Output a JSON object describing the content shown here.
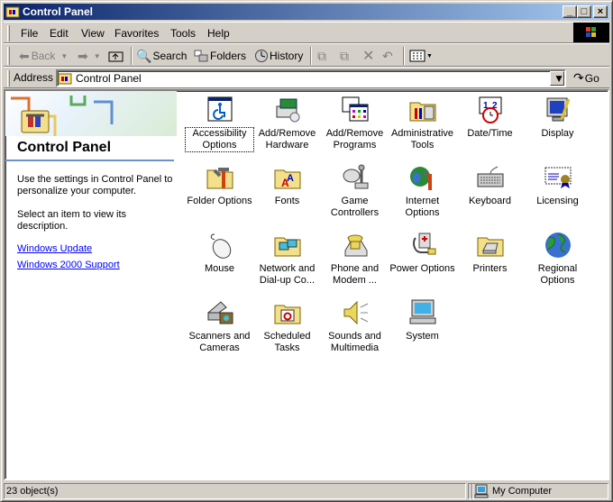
{
  "window": {
    "title": "Control Panel",
    "buttons": {
      "minimize": "_",
      "maximize": "□",
      "close": "×"
    }
  },
  "menubar": {
    "items": [
      "File",
      "Edit",
      "View",
      "Favorites",
      "Tools",
      "Help"
    ]
  },
  "toolbar": {
    "back": "Back",
    "search": "Search",
    "folders": "Folders",
    "history": "History"
  },
  "addressbar": {
    "label": "Address",
    "value": "Control Panel",
    "go": "Go"
  },
  "leftpane": {
    "title": "Control Panel",
    "description": "Use the settings in Control Panel to personalize your computer.",
    "hint": "Select an item to view its description.",
    "links": [
      "Windows Update",
      "Windows 2000 Support"
    ]
  },
  "items": [
    {
      "label": "Accessibility Options",
      "icon": "accessibility-icon"
    },
    {
      "label": "Add/Remove Hardware",
      "icon": "add-remove-hardware-icon"
    },
    {
      "label": "Add/Remove Programs",
      "icon": "add-remove-programs-icon"
    },
    {
      "label": "Administrative Tools",
      "icon": "administrative-tools-icon"
    },
    {
      "label": "Date/Time",
      "icon": "date-time-icon"
    },
    {
      "label": "Display",
      "icon": "display-icon"
    },
    {
      "label": "Folder Options",
      "icon": "folder-options-icon"
    },
    {
      "label": "Fonts",
      "icon": "fonts-icon"
    },
    {
      "label": "Game Controllers",
      "icon": "game-controllers-icon"
    },
    {
      "label": "Internet Options",
      "icon": "internet-options-icon"
    },
    {
      "label": "Keyboard",
      "icon": "keyboard-icon"
    },
    {
      "label": "Licensing",
      "icon": "licensing-icon"
    },
    {
      "label": "Mouse",
      "icon": "mouse-icon"
    },
    {
      "label": "Network and Dial-up Co...",
      "icon": "network-icon"
    },
    {
      "label": "Phone and Modem ...",
      "icon": "phone-modem-icon"
    },
    {
      "label": "Power Options",
      "icon": "power-options-icon"
    },
    {
      "label": "Printers",
      "icon": "printers-icon"
    },
    {
      "label": "Regional Options",
      "icon": "regional-options-icon"
    },
    {
      "label": "Scanners and Cameras",
      "icon": "scanners-cameras-icon"
    },
    {
      "label": "Scheduled Tasks",
      "icon": "scheduled-tasks-icon"
    },
    {
      "label": "Sounds and Multimedia",
      "icon": "sounds-multimedia-icon"
    },
    {
      "label": "System",
      "icon": "system-icon"
    }
  ],
  "statusbar": {
    "count": "23 object(s)",
    "zone": "My Computer"
  },
  "colors": {
    "titlebar_start": "#0a246a",
    "titlebar_end": "#a6caf0",
    "face": "#d4d0c8",
    "link": "#0000ff"
  }
}
